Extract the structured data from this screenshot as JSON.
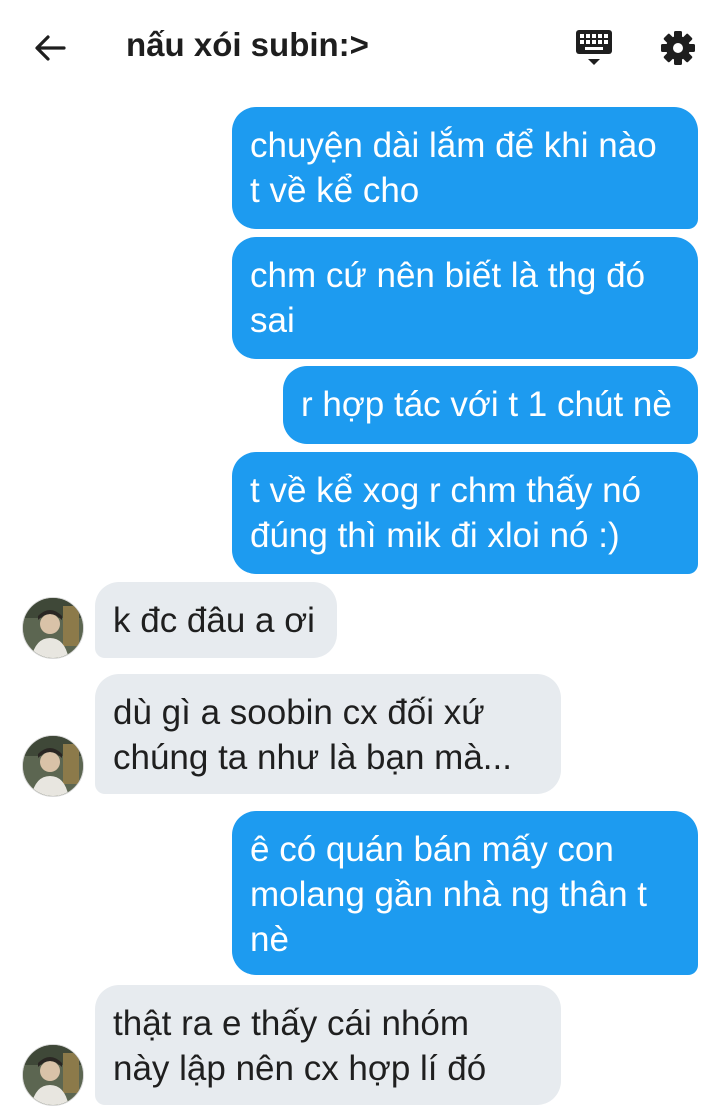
{
  "header": {
    "title": "nấu xói subin:>"
  },
  "messages": [
    {
      "direction": "outgoing",
      "lines": [
        "chuyện dài lắm để khi nào",
        "t về kể cho"
      ]
    },
    {
      "direction": "outgoing",
      "lines": [
        "chm cứ nên biết là thg đó",
        "sai"
      ]
    },
    {
      "direction": "outgoing",
      "lines": [
        "r hợp tác với t 1 chút nè"
      ]
    },
    {
      "direction": "outgoing",
      "lines": [
        "t về kể xog r chm thấy nó",
        "đúng thì mik đi xloi nó :)"
      ]
    },
    {
      "direction": "incoming",
      "lines": [
        "k đc đâu a ơi"
      ]
    },
    {
      "direction": "incoming",
      "lines": [
        "dù gì a soobin cx đối xứ",
        "chúng ta như là bạn mà..."
      ]
    },
    {
      "direction": "outgoing",
      "lines": [
        "ê có quán bán mấy con",
        "molang gần nhà ng thân t",
        "nè"
      ]
    },
    {
      "direction": "incoming",
      "lines": [
        "thật ra e thấy cái nhóm",
        "này lập nên cx hợp lí đó"
      ]
    }
  ],
  "colors": {
    "outgoing_bubble": "#1d9bf0",
    "incoming_bubble": "#e7ebef",
    "header_text": "#1e1e1e"
  },
  "icons": {
    "back": "arrow-left-icon",
    "keyboard": "keyboard-icon",
    "settings": "gear-icon",
    "avatar": "avatar"
  }
}
